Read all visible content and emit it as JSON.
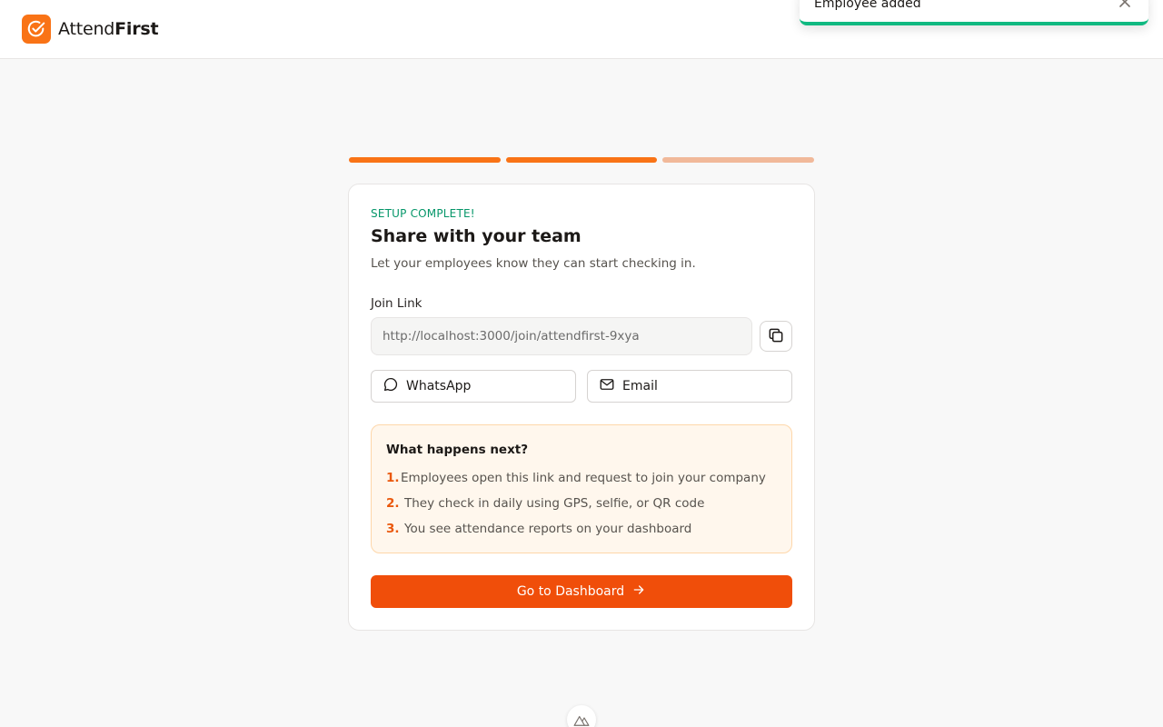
{
  "header": {
    "brand_prefix": "Attend",
    "brand_suffix": "First",
    "logo_icon": "check-circle-icon"
  },
  "toast": {
    "message": "Employee added",
    "close_icon": "close-icon"
  },
  "progress": {
    "steps_total": 3,
    "steps_complete": 2
  },
  "card": {
    "eyebrow": "SETUP COMPLETE!",
    "title": "Share with your team",
    "subtitle": "Let your employees know they can start checking in.",
    "join_link_label": "Join Link",
    "join_link_value": "http://localhost:3000/join/attendfirst-9xya",
    "copy_icon": "copy-icon",
    "share": {
      "whatsapp_label": "WhatsApp",
      "whatsapp_icon": "chat-bubble-icon",
      "email_label": "Email",
      "email_icon": "mail-icon"
    },
    "next": {
      "title": "What happens next?",
      "steps": [
        {
          "num": "1.",
          "text": "Employees open this link and request to join your company"
        },
        {
          "num": "2.",
          "text": "They check in daily using GPS, selfie, or QR code"
        },
        {
          "num": "3.",
          "text": "You see attendance reports on your dashboard"
        }
      ]
    },
    "cta_label": "Go to Dashboard",
    "cta_icon": "arrow-right-icon"
  },
  "colors": {
    "accent": "#f97316",
    "cta": "#f04e0a",
    "success": "#059669",
    "toast_bar": "#10b981",
    "next_bg": "#fff7ed"
  }
}
